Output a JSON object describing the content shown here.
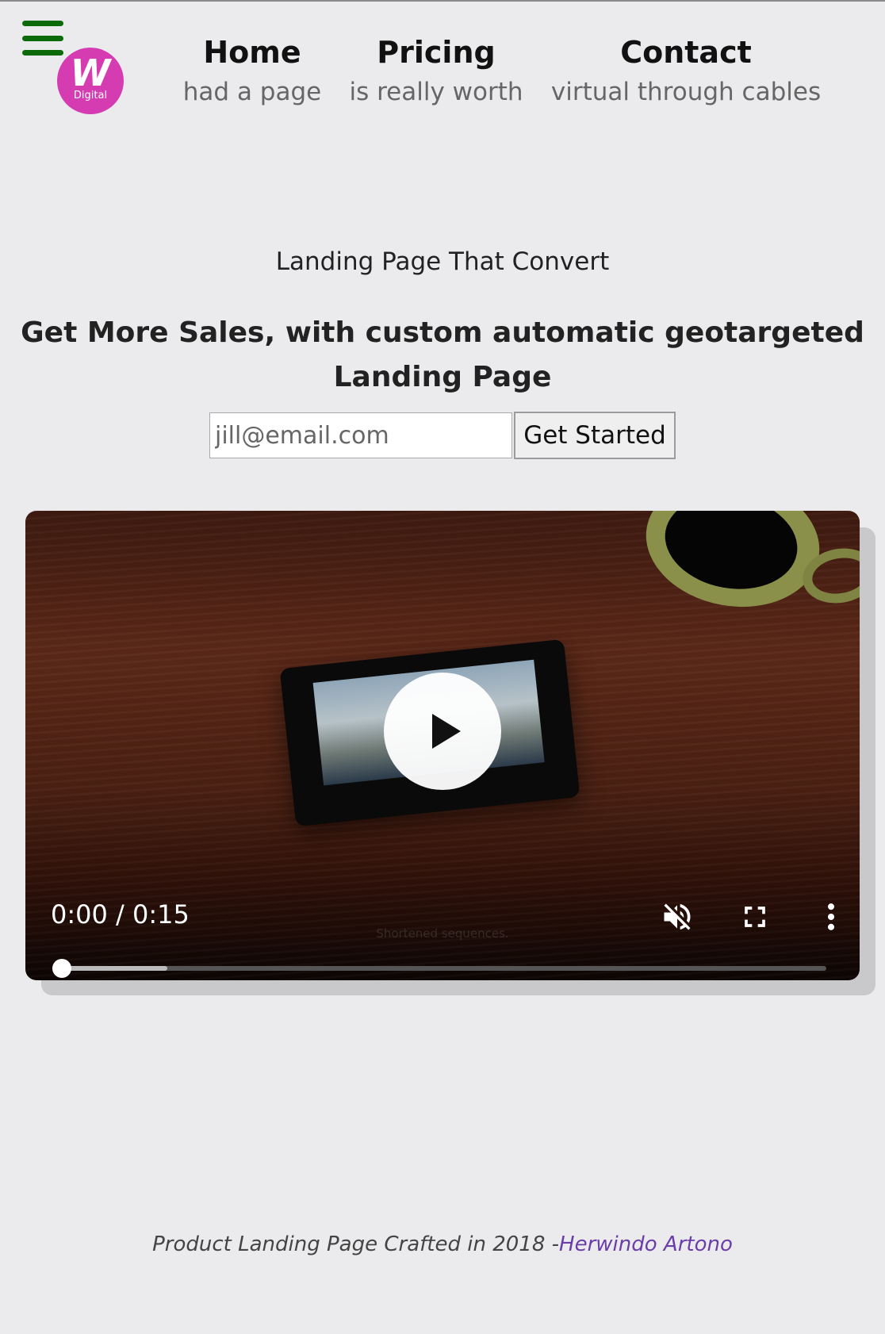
{
  "header": {
    "menu_icon": "hamburger-menu-icon",
    "logo": {
      "letter": "W",
      "subtitle": "Digital",
      "color": "#d63cb2"
    },
    "nav": [
      {
        "title": "Home",
        "subtitle": "had a page"
      },
      {
        "title": "Pricing",
        "subtitle": "is really worth"
      },
      {
        "title": "Contact",
        "subtitle": "virtual through cables"
      }
    ]
  },
  "hero": {
    "kicker": "Landing Page That Convert",
    "headline": "Get More Sales, with custom automatic geotargeted Landing Page",
    "email_placeholder": "jill@email.com",
    "cta_label": "Get Started"
  },
  "video": {
    "time_display": "0:00 / 0:15",
    "caption": "Shortened sequences.",
    "play_icon": "play-icon",
    "mute_icon": "muted-speaker-icon",
    "fullscreen_icon": "fullscreen-icon",
    "more_icon": "more-vertical-icon",
    "played_fraction": 0.0,
    "buffered_fraction": 0.14
  },
  "footer": {
    "text": "Product Landing Page Crafted in 2018 -",
    "author": "Herwindo Artono",
    "link_color": "#6a3da8"
  },
  "colors": {
    "menu": "#0b6b0b",
    "background": "#ebebed"
  }
}
